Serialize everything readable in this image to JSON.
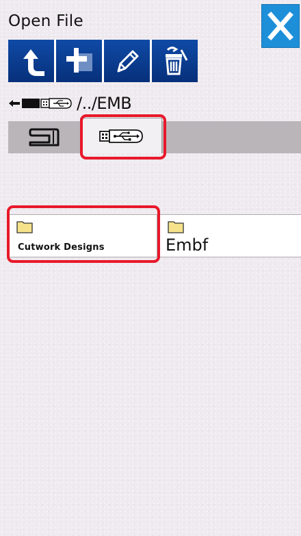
{
  "window": {
    "title": "Open File"
  },
  "toolbar": {
    "buttons": [
      {
        "name": "up-folder",
        "icon": "up-arrow-icon"
      },
      {
        "name": "new-folder",
        "icon": "add-folder-icon"
      },
      {
        "name": "rename",
        "icon": "pencil-icon"
      },
      {
        "name": "delete",
        "icon": "trash-icon"
      }
    ]
  },
  "path": {
    "text": "/../EMB"
  },
  "tabs": [
    {
      "name": "machine",
      "icon": "sewing-machine-icon",
      "active": false
    },
    {
      "name": "usb",
      "icon": "usb-icon",
      "active": true
    }
  ],
  "folders": [
    {
      "label": "Cutwork Designs",
      "icon": "folder-icon"
    },
    {
      "label": "Embf",
      "icon": "folder-icon"
    }
  ],
  "colors": {
    "toolbar_blue": "#0a3d8f",
    "close_blue": "#1d8fd9",
    "highlight_red": "#e8182a",
    "folder_yellow": "#f5e28a",
    "tab_strip_gray": "#b9b5b9"
  }
}
